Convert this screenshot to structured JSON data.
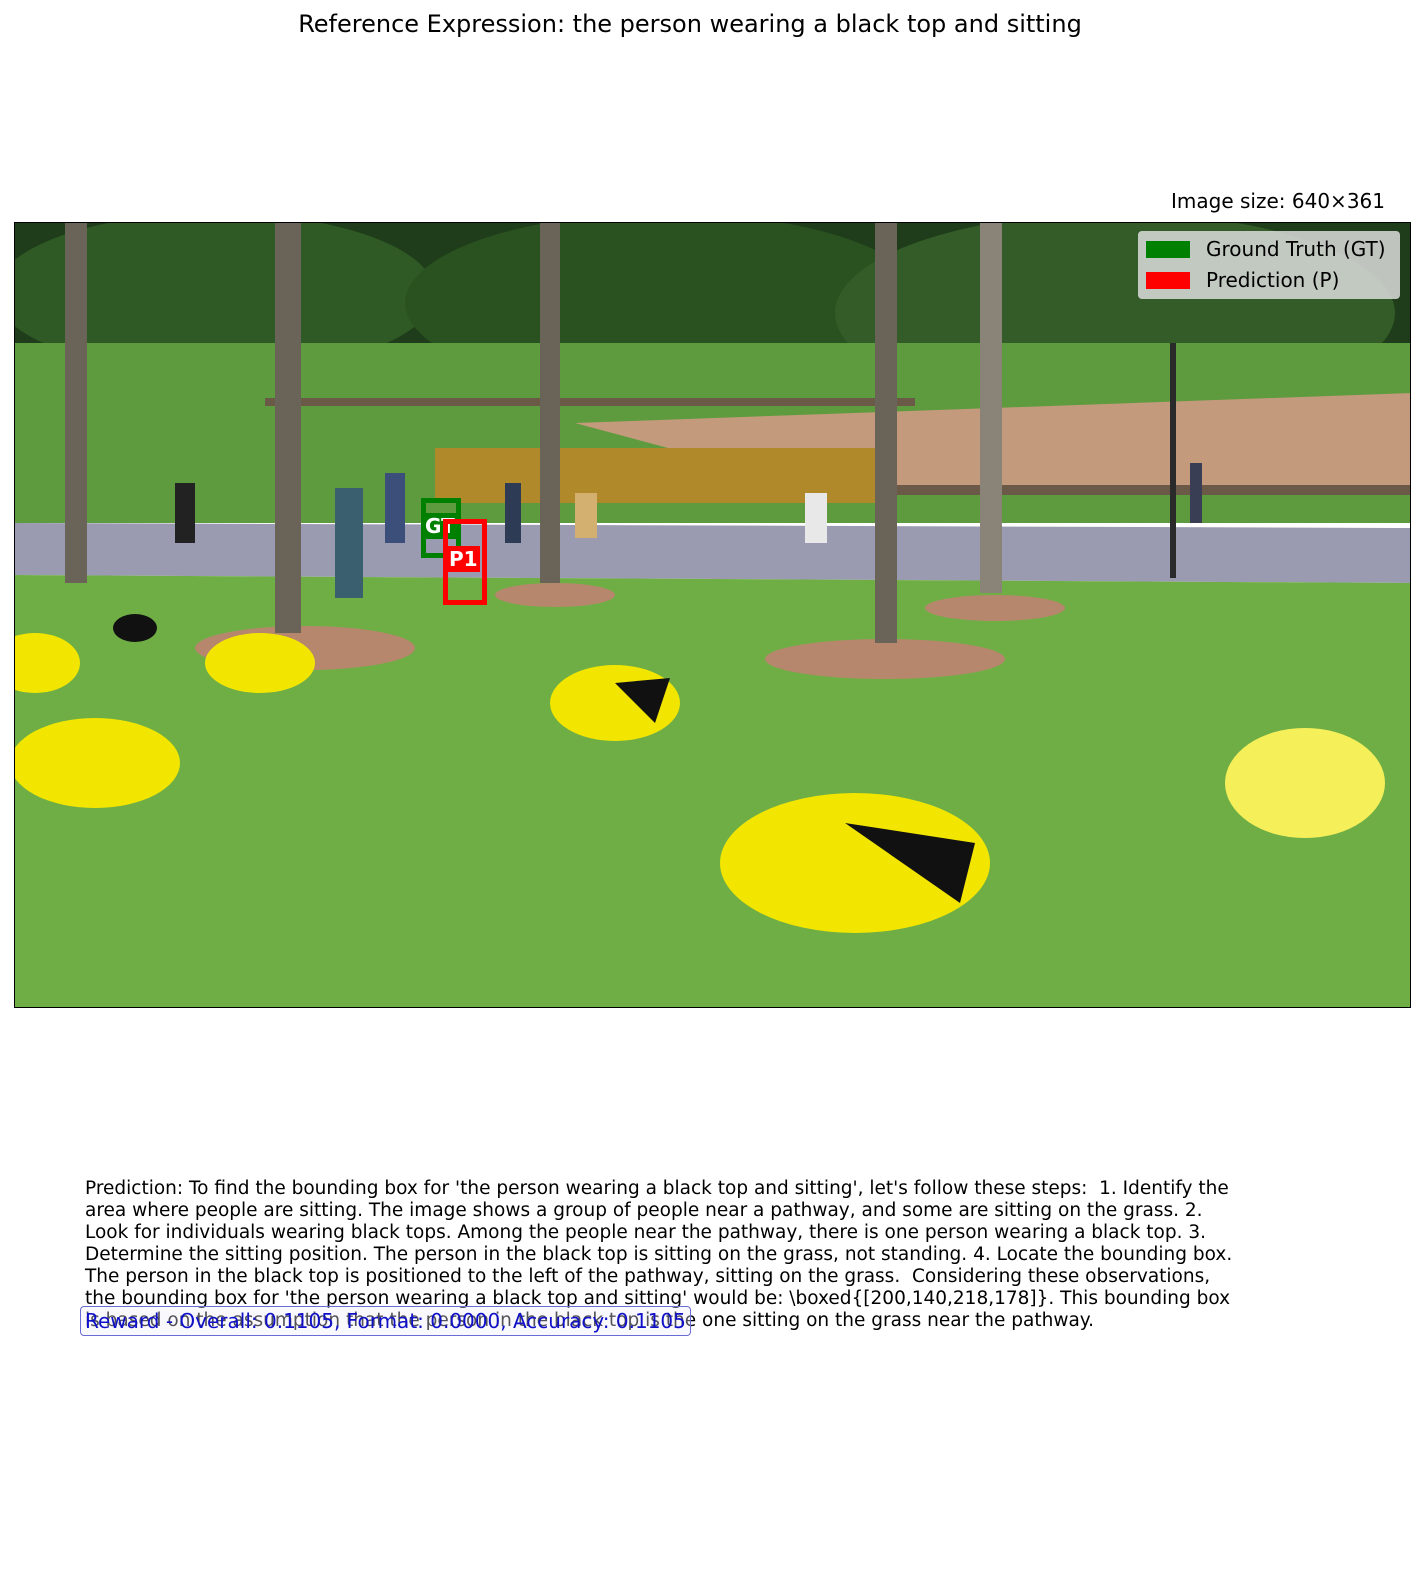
{
  "title": "Reference Expression: the person wearing a black top and sitting",
  "image_size_text": "Image size: 640×361",
  "legend": {
    "items": [
      {
        "label": "Ground Truth (GT)",
        "color": "#008000"
      },
      {
        "label": "Prediction (P)",
        "color": "#ff0000"
      }
    ]
  },
  "boxes": {
    "gt": {
      "label": "GT",
      "color": "#008000"
    },
    "p1": {
      "label": "P1",
      "color": "#ff0000"
    }
  },
  "prediction_text": "Prediction: To find the bounding box for 'the person wearing a black top and sitting', let's follow these steps:  1. Identify the area where people are sitting. The image shows a group of people near a pathway, and some are sitting on the grass. 2. Look for individuals wearing black tops. Among the people near the pathway, there is one person wearing a black top. 3. Determine the sitting position. The person in the black top is sitting on the grass, not standing. 4. Locate the bounding box. The person in the black top is positioned to the left of the pathway, sitting on the grass.  Considering these observations, the bounding box for 'the person wearing a black top and sitting' would be: \\boxed{[200,140,218,178]}. This bounding box is based on the assumption that the person in the black top is the one sitting on the grass near the pathway.",
  "reward_text": "Reward - Overall: 0.1105, Format: 0.0000, Accuracy: 0.1105"
}
